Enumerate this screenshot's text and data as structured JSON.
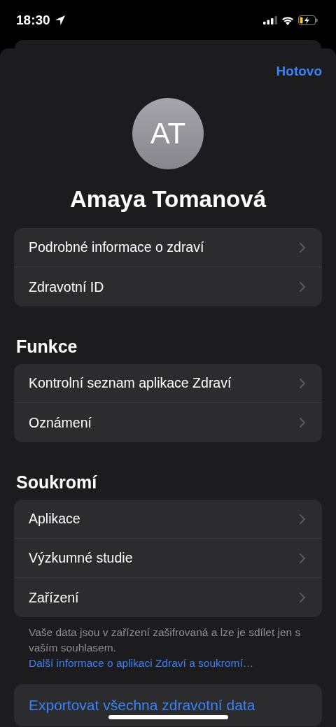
{
  "status_bar": {
    "time": "18:30"
  },
  "done_button": "Hotovo",
  "profile": {
    "initials": "AT",
    "name": "Amaya Tomanová"
  },
  "groups": [
    {
      "items": [
        "Podrobné informace o zdraví",
        "Zdravotní ID"
      ]
    },
    {
      "title": "Funkce",
      "items": [
        "Kontrolní seznam aplikace Zdraví",
        "Oznámení"
      ]
    },
    {
      "title": "Soukromí",
      "items": [
        "Aplikace",
        "Výzkumné studie",
        "Zařízení"
      ],
      "footer": "Vaše data jsou v zařízení zašifrovaná a lze je sdílet jen s vaším souhlasem.",
      "footer_link": "Další informace o aplikaci Zdraví a soukromí…"
    }
  ],
  "export_button": "Exportovat všechna zdravotní data"
}
